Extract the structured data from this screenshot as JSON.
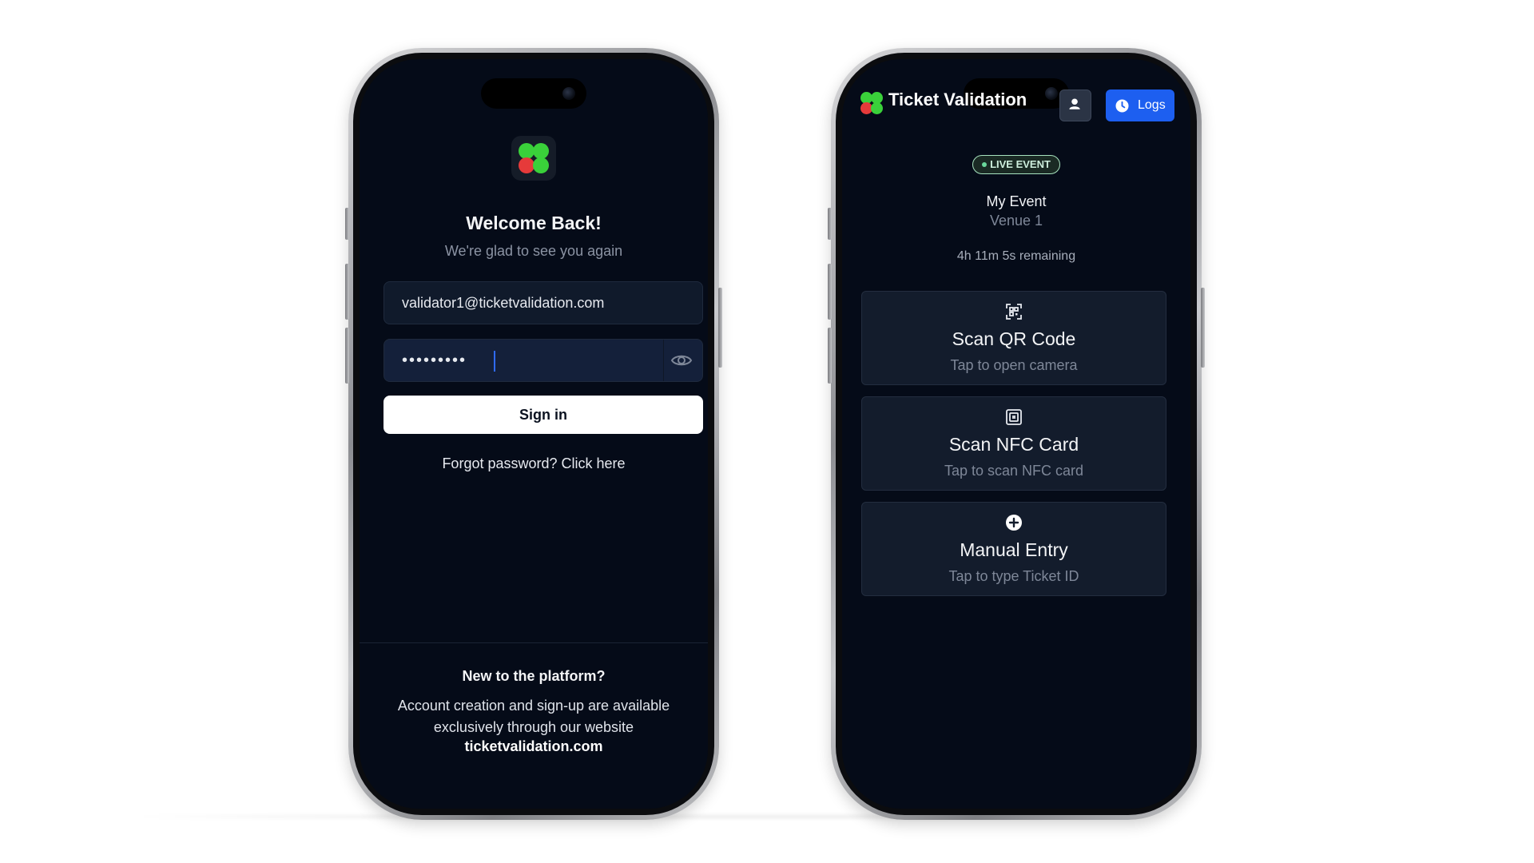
{
  "login": {
    "title": "Welcome Back!",
    "subtitle": "We're glad to see you again",
    "email_value": "validator1@ticketvalidation.com",
    "password_value": "•••••••••",
    "signin_label": "Sign in",
    "forgot_label": "Forgot password? Click here",
    "new_title": "New to the platform?",
    "new_text": "Account creation and sign-up are available exclusively through our website",
    "website": "ticketvalidation.com"
  },
  "dashboard": {
    "app_title": "Ticket Validation",
    "logs_label": "Logs",
    "live_badge": "LIVE EVENT",
    "event_name": "My Event",
    "venue": "Venue 1",
    "remaining": "4h 11m 5s remaining",
    "actions": [
      {
        "title": "Scan QR Code",
        "subtitle": "Tap to open camera",
        "icon": "qr-scan-icon"
      },
      {
        "title": "Scan NFC Card",
        "subtitle": "Tap to scan NFC card",
        "icon": "nfc-icon"
      },
      {
        "title": "Manual Entry",
        "subtitle": "Tap to type Ticket ID",
        "icon": "plus-circle-icon"
      }
    ]
  },
  "colors": {
    "screen_bg": "#050b18",
    "card_bg": "#131c2c",
    "accent_blue": "#1d5ff0",
    "clover_green": "#3ad13a",
    "clover_red": "#e63a3a",
    "live_green": "#a7e3bf"
  }
}
